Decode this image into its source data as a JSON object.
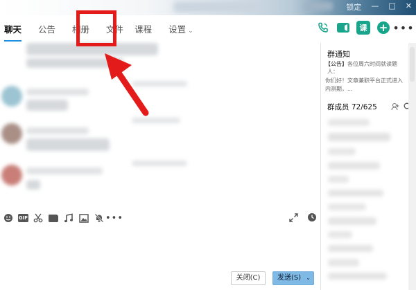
{
  "window": {
    "controls": [
      "锁定",
      "—",
      "□",
      "✕"
    ]
  },
  "tabs": [
    {
      "label": "聊天",
      "active": true
    },
    {
      "label": "公告",
      "active": false
    },
    {
      "label": "相册",
      "active": false
    },
    {
      "label": "文件",
      "active": false
    },
    {
      "label": "课程",
      "active": false
    },
    {
      "label": "设置",
      "active": false,
      "caret": "⌄"
    }
  ],
  "header_icons": {
    "phone": "phone-icon",
    "video": "video-icon",
    "course_label": "课",
    "add": "plus-icon",
    "more_label": "•••"
  },
  "toolbar": {
    "gif_label": "GIF",
    "more_label": "•••"
  },
  "buttons": {
    "close_label": "关闭(C)",
    "send_label": "发送(S)",
    "send_dropdown": "⌄"
  },
  "right_panel": {
    "notice_title": "群通知",
    "notice_tag": "【公告】",
    "notice_line1": "各位周六时间就读题",
    "notice_line2": "人：",
    "notice_line3": "你们好！文章兼职平台正式进入",
    "notice_line4": "内测期，...",
    "members_label": "群成员",
    "members_count": "72/625"
  },
  "colors": {
    "accent": "#1e8fe1",
    "brand_green": "#18a58b",
    "highlight_red": "#e31b1b",
    "send_button": "#7fb9e6"
  }
}
